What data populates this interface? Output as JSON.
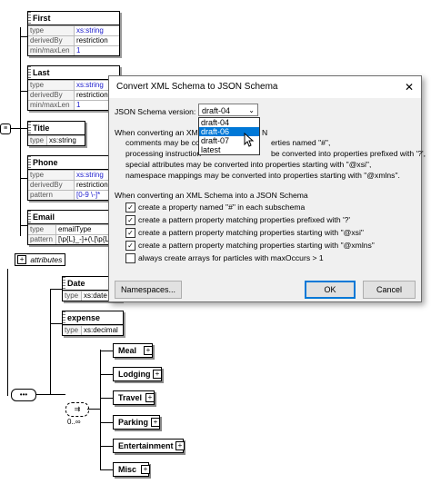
{
  "schema": {
    "first": {
      "title": "First",
      "rows": [
        [
          "type",
          "xs:string"
        ],
        [
          "derivedBy",
          "restriction"
        ],
        [
          "min/maxLen",
          "1"
        ]
      ]
    },
    "last": {
      "title": "Last",
      "rows": [
        [
          "type",
          "xs:string"
        ],
        [
          "derivedBy",
          "restriction"
        ],
        [
          "min/maxLen",
          "1"
        ]
      ]
    },
    "title_el": {
      "title": "Title",
      "rows": [
        [
          "type",
          "xs:string"
        ]
      ]
    },
    "phone": {
      "title": "Phone",
      "rows": [
        [
          "type",
          "xs:string"
        ],
        [
          "derivedBy",
          "restriction"
        ],
        [
          "pattern",
          "[0-9 \\-]*"
        ]
      ]
    },
    "email": {
      "title": "Email",
      "rows": [
        [
          "type",
          "emailType"
        ],
        [
          "pattern",
          "[\\p{L}_-]+(\\.[\\p{L}"
        ]
      ]
    },
    "attributes_label": "attributes",
    "date": {
      "title": "Date",
      "rows": [
        [
          "type",
          "xs:date"
        ]
      ]
    },
    "expense": {
      "title": "expense",
      "rows": [
        [
          "type",
          "xs:decimal"
        ]
      ]
    },
    "choice_items": [
      "Meal",
      "Lodging",
      "Travel",
      "Parking",
      "Entertainment",
      "Misc"
    ],
    "occurs": "0..∞"
  },
  "dialog": {
    "title": "Convert XML Schema to JSON Schema",
    "version_label": "JSON Schema version:",
    "version_selected": "draft-04",
    "version_options": [
      "draft-04",
      "draft-06",
      "draft-07",
      "latest"
    ],
    "version_highlight": "draft-06",
    "para1_line1": "When converting an XML",
    "para1_line1_tail": "N",
    "para1_line2": "comments may be con",
    "para1_line2_tail": "erties named \"#\",",
    "para1_line3": "processing instruction",
    "para1_line3_tail": "be converted into properties prefixed with '?',",
    "para1_line4": "special attributes may be converted into properties starting with \"@xsi\",",
    "para1_line5": "namespace mappings may be converted into properties starting with \"@xmlns\".",
    "para2_heading": "When converting an XML Schema into a JSON Schema",
    "options": [
      {
        "label": "create a property named \"#\" in each subschema",
        "checked": true
      },
      {
        "label": "create a pattern property matching properties prefixed with '?'",
        "checked": true
      },
      {
        "label": "create a pattern property matching properties starting with \"@xsi\"",
        "checked": true
      },
      {
        "label": "create a pattern property matching properties starting with \"@xmlns\"",
        "checked": true
      },
      {
        "label": "always create arrays for particles with maxOccurs > 1",
        "checked": false
      }
    ],
    "namespaces_btn": "Namespaces...",
    "ok_btn": "OK",
    "cancel_btn": "Cancel",
    "close_glyph": "✕"
  }
}
